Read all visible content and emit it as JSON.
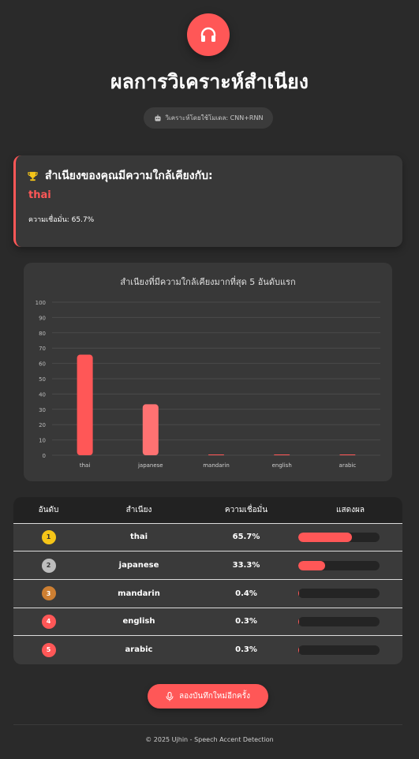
{
  "header": {
    "icon": "headphones-icon",
    "title": "ผลการวิเคราะห์สำเนียง",
    "model_icon": "robot-icon",
    "model_label": "วิเคราะห์โดยใช้โมเดล: CNN+RNN"
  },
  "result": {
    "icon": "trophy-icon",
    "heading": "สำเนียงของคุณมีความใกล้เคียงกับ:",
    "accent": "thai",
    "confidence": "ความเชื่อมั่น: 65.7%"
  },
  "chart_data": {
    "type": "bar",
    "title": "สำเนียงที่มีความใกล้เคียงมากที่สุด 5 อันดับแรก",
    "categories": [
      "thai",
      "japanese",
      "mandarin",
      "english",
      "arabic"
    ],
    "values": [
      65.7,
      33.3,
      0.4,
      0.3,
      0.3
    ],
    "ylim": [
      0,
      100
    ],
    "yticks": [
      0,
      10,
      20,
      30,
      40,
      50,
      60,
      70,
      80,
      90,
      100
    ],
    "grid": true,
    "colors": [
      "#ff5757",
      "#ff7272",
      "#ff5757",
      "#ff5757",
      "#ff5757"
    ]
  },
  "table": {
    "headers": [
      "อันดับ",
      "สำเนียง",
      "ความเชื่อมั่น",
      "แสดงผล"
    ],
    "rows": [
      {
        "rank": "1",
        "accent": "thai",
        "confidence": "65.7%",
        "fill": 0.657,
        "rank_color": "#f5c518",
        "rank_text_color": "#333"
      },
      {
        "rank": "2",
        "accent": "japanese",
        "confidence": "33.3%",
        "fill": 0.333,
        "rank_color": "#bdbdbd",
        "rank_text_color": "#333"
      },
      {
        "rank": "3",
        "accent": "mandarin",
        "confidence": "0.4%",
        "fill": 0.004,
        "rank_color": "#cd7f32",
        "rank_text_color": "#fff"
      },
      {
        "rank": "4",
        "accent": "english",
        "confidence": "0.3%",
        "fill": 0.003,
        "rank_color": "#ff5757",
        "rank_text_color": "#fff"
      },
      {
        "rank": "5",
        "accent": "arabic",
        "confidence": "0.3%",
        "fill": 0.003,
        "rank_color": "#ff5757",
        "rank_text_color": "#fff"
      }
    ]
  },
  "actions": {
    "retry_icon": "microphone-icon",
    "retry_label": "ลองบันทึกใหม่อีกครั้ง"
  },
  "footer": {
    "text": "© 2025 Ujhin - Speech Accent Detection"
  },
  "colors": {
    "accent": "#ff5757",
    "background": "#2a2a2a",
    "card": "#383838"
  }
}
